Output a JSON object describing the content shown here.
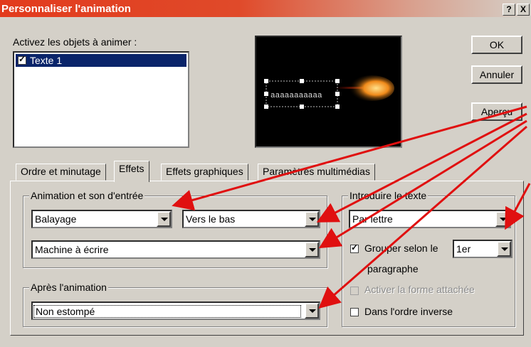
{
  "window": {
    "title": "Personnaliser l'animation",
    "help_btn": "?",
    "close_btn": "X"
  },
  "objects": {
    "label": "Activez les objets à animer :",
    "items": [
      {
        "label": "Texte 1",
        "checked": true
      }
    ]
  },
  "preview": {
    "sample_text": "aaaaaaaaaaa"
  },
  "buttons": {
    "ok": "OK",
    "cancel": "Annuler",
    "preview": "Aperçu"
  },
  "tabs": [
    "Ordre et minutage",
    "Effets",
    "Effets graphiques",
    "Paramètres multimédias"
  ],
  "active_tab": "Effets",
  "entry_group": {
    "title": "Animation et son d'entrée",
    "effect": "Balayage",
    "direction": "Vers le bas",
    "sound": "Machine à écrire"
  },
  "after_group": {
    "title": "Après l'animation",
    "value": "Non estompé"
  },
  "text_group": {
    "title": "Introduire le texte",
    "mode": "Par lettre",
    "group_label": "Grouper selon le",
    "group_value": "1er",
    "group_suffix": "paragraphe",
    "group_checked": true,
    "attach_label": "Activer la forme attachée",
    "reverse_label": "Dans l'ordre inverse",
    "reverse_checked": false
  },
  "colors": {
    "title_start": "#e23b1d",
    "annotation_arrow": "#e01010",
    "selection": "#0a246a"
  }
}
